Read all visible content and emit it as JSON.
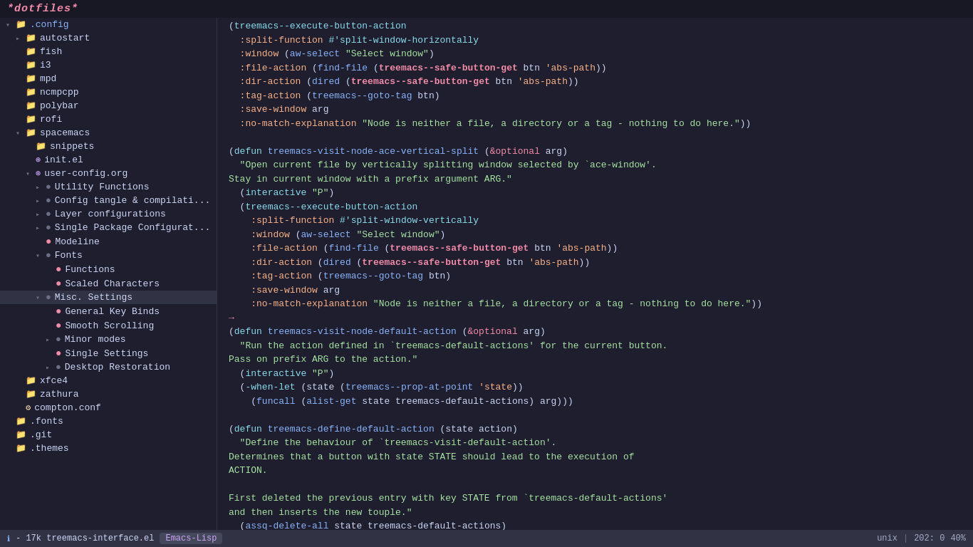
{
  "titleBar": {
    "text": "*dotfiles*"
  },
  "sidebar": {
    "items": [
      {
        "id": "config",
        "label": ".config",
        "type": "folder-open",
        "indent": 0
      },
      {
        "id": "autostart",
        "label": "autostart",
        "type": "folder",
        "indent": 1
      },
      {
        "id": "fish",
        "label": "fish",
        "type": "folder",
        "indent": 1
      },
      {
        "id": "i3",
        "label": "i3",
        "type": "folder",
        "indent": 1
      },
      {
        "id": "mpd",
        "label": "mpd",
        "type": "folder",
        "indent": 1
      },
      {
        "id": "ncmpcpp",
        "label": "ncmpcpp",
        "type": "folder",
        "indent": 1
      },
      {
        "id": "polybar",
        "label": "polybar",
        "type": "folder",
        "indent": 1
      },
      {
        "id": "rofi",
        "label": "rofi",
        "type": "folder",
        "indent": 1
      },
      {
        "id": "spacemacs",
        "label": "spacemacs",
        "type": "folder-open",
        "indent": 1
      },
      {
        "id": "snippets",
        "label": "snippets",
        "type": "folder",
        "indent": 2
      },
      {
        "id": "init-el",
        "label": "init.el",
        "type": "spacemacs",
        "indent": 2
      },
      {
        "id": "user-config",
        "label": "user-config.org",
        "type": "spacemacs",
        "indent": 2
      },
      {
        "id": "utility-functions",
        "label": "Utility Functions",
        "type": "arrow-closed",
        "indent": 3
      },
      {
        "id": "config-tangle",
        "label": "Config tangle & compilati...",
        "type": "arrow-closed",
        "indent": 3
      },
      {
        "id": "layer-config",
        "label": "Layer configurations",
        "type": "arrow-closed",
        "indent": 3
      },
      {
        "id": "single-package",
        "label": "Single Package Configurat...",
        "type": "arrow-closed",
        "indent": 3
      },
      {
        "id": "modeline",
        "label": "Modeline",
        "type": "dot-red",
        "indent": 3
      },
      {
        "id": "fonts",
        "label": "Fonts",
        "type": "arrow-open",
        "indent": 3
      },
      {
        "id": "functions",
        "label": "Functions",
        "type": "dot-red",
        "indent": 4
      },
      {
        "id": "scaled-chars",
        "label": "Scaled Characters",
        "type": "dot-red",
        "indent": 4
      },
      {
        "id": "misc-settings",
        "label": "Misc. Settings",
        "type": "arrow-open",
        "indent": 3,
        "selected": true
      },
      {
        "id": "general-key-binds",
        "label": "General Key Binds",
        "type": "dot-red",
        "indent": 4
      },
      {
        "id": "smooth-scrolling",
        "label": "Smooth Scrolling",
        "type": "dot-red",
        "indent": 4
      },
      {
        "id": "minor-modes",
        "label": "Minor modes",
        "type": "arrow-closed",
        "indent": 4
      },
      {
        "id": "single-settings",
        "label": "Single Settings",
        "type": "dot-red",
        "indent": 4
      },
      {
        "id": "desktop-restoration",
        "label": "Desktop Restoration",
        "type": "arrow-closed",
        "indent": 4
      },
      {
        "id": "xfce4",
        "label": "xfce4",
        "type": "folder",
        "indent": 1
      },
      {
        "id": "zathura",
        "label": "zathura",
        "type": "folder",
        "indent": 1
      },
      {
        "id": "compton",
        "label": "compton.conf",
        "type": "gear",
        "indent": 1
      },
      {
        "id": "fonts-dir",
        "label": ".fonts",
        "type": "folder",
        "indent": 0
      },
      {
        "id": "git",
        "label": ".git",
        "type": "folder",
        "indent": 0
      },
      {
        "id": "themes",
        "label": ".themes",
        "type": "folder-partial",
        "indent": 0
      }
    ]
  },
  "editor": {
    "code": ""
  },
  "statusBar": {
    "icon": "ℹ",
    "size": "17k",
    "filename": "treemacs-interface.el",
    "mode": "Emacs-Lisp",
    "encoding": "unix",
    "position": "202: 0",
    "percent": "40%"
  }
}
